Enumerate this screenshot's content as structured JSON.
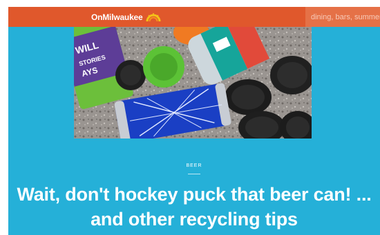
{
  "header": {
    "logo_text": "OnMilwaukee",
    "logo_icon": "sunburst-icon",
    "search_placeholder": "dining, bars, summer..."
  },
  "hero": {
    "image_icon": "beer-cans-and-pucks-photo"
  },
  "article": {
    "category": "BEER",
    "headline": "Wait, don't hockey puck that beer can! ... and other recycling tips"
  },
  "colors": {
    "page_background": "#25b0d8",
    "header_background": "#e0582c",
    "search_background": "#e57147",
    "text": "#ffffff"
  }
}
